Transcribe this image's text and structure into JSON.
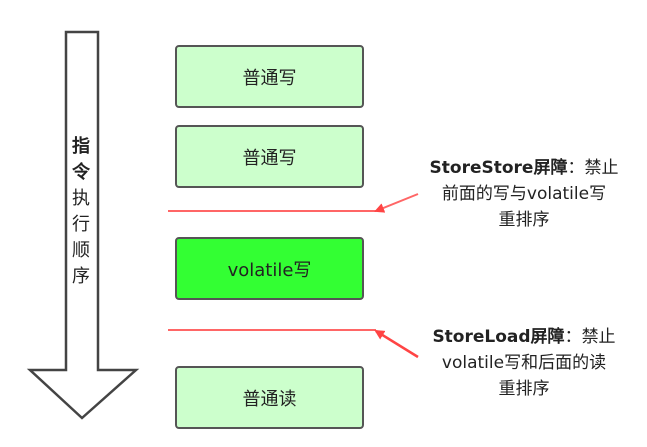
{
  "order_label": {
    "bold_chars": [
      "指",
      "令"
    ],
    "normal_chars": [
      "执",
      "行",
      "顺",
      "序"
    ]
  },
  "operations": [
    {
      "label": "普通写",
      "highlight": false
    },
    {
      "label": "普通写",
      "highlight": false
    },
    {
      "label": "volatile写",
      "highlight": true
    },
    {
      "label": "普通读",
      "highlight": false
    }
  ],
  "barriers": [
    {
      "name": "StoreStore屏障",
      "sep": "：",
      "line1_rest": "禁止",
      "line2": "前面的写与volatile写",
      "line3": "重排序"
    },
    {
      "name": "StoreLoad屏障",
      "sep": "：",
      "line1_rest": "禁止",
      "line2": "volatile写和后面的读",
      "line3": "重排序"
    }
  ],
  "colors": {
    "box_normal": "#ccffcc",
    "box_highlight": "#33ff33",
    "barrier": "#ff6666",
    "arrow_outline": "#444444"
  }
}
